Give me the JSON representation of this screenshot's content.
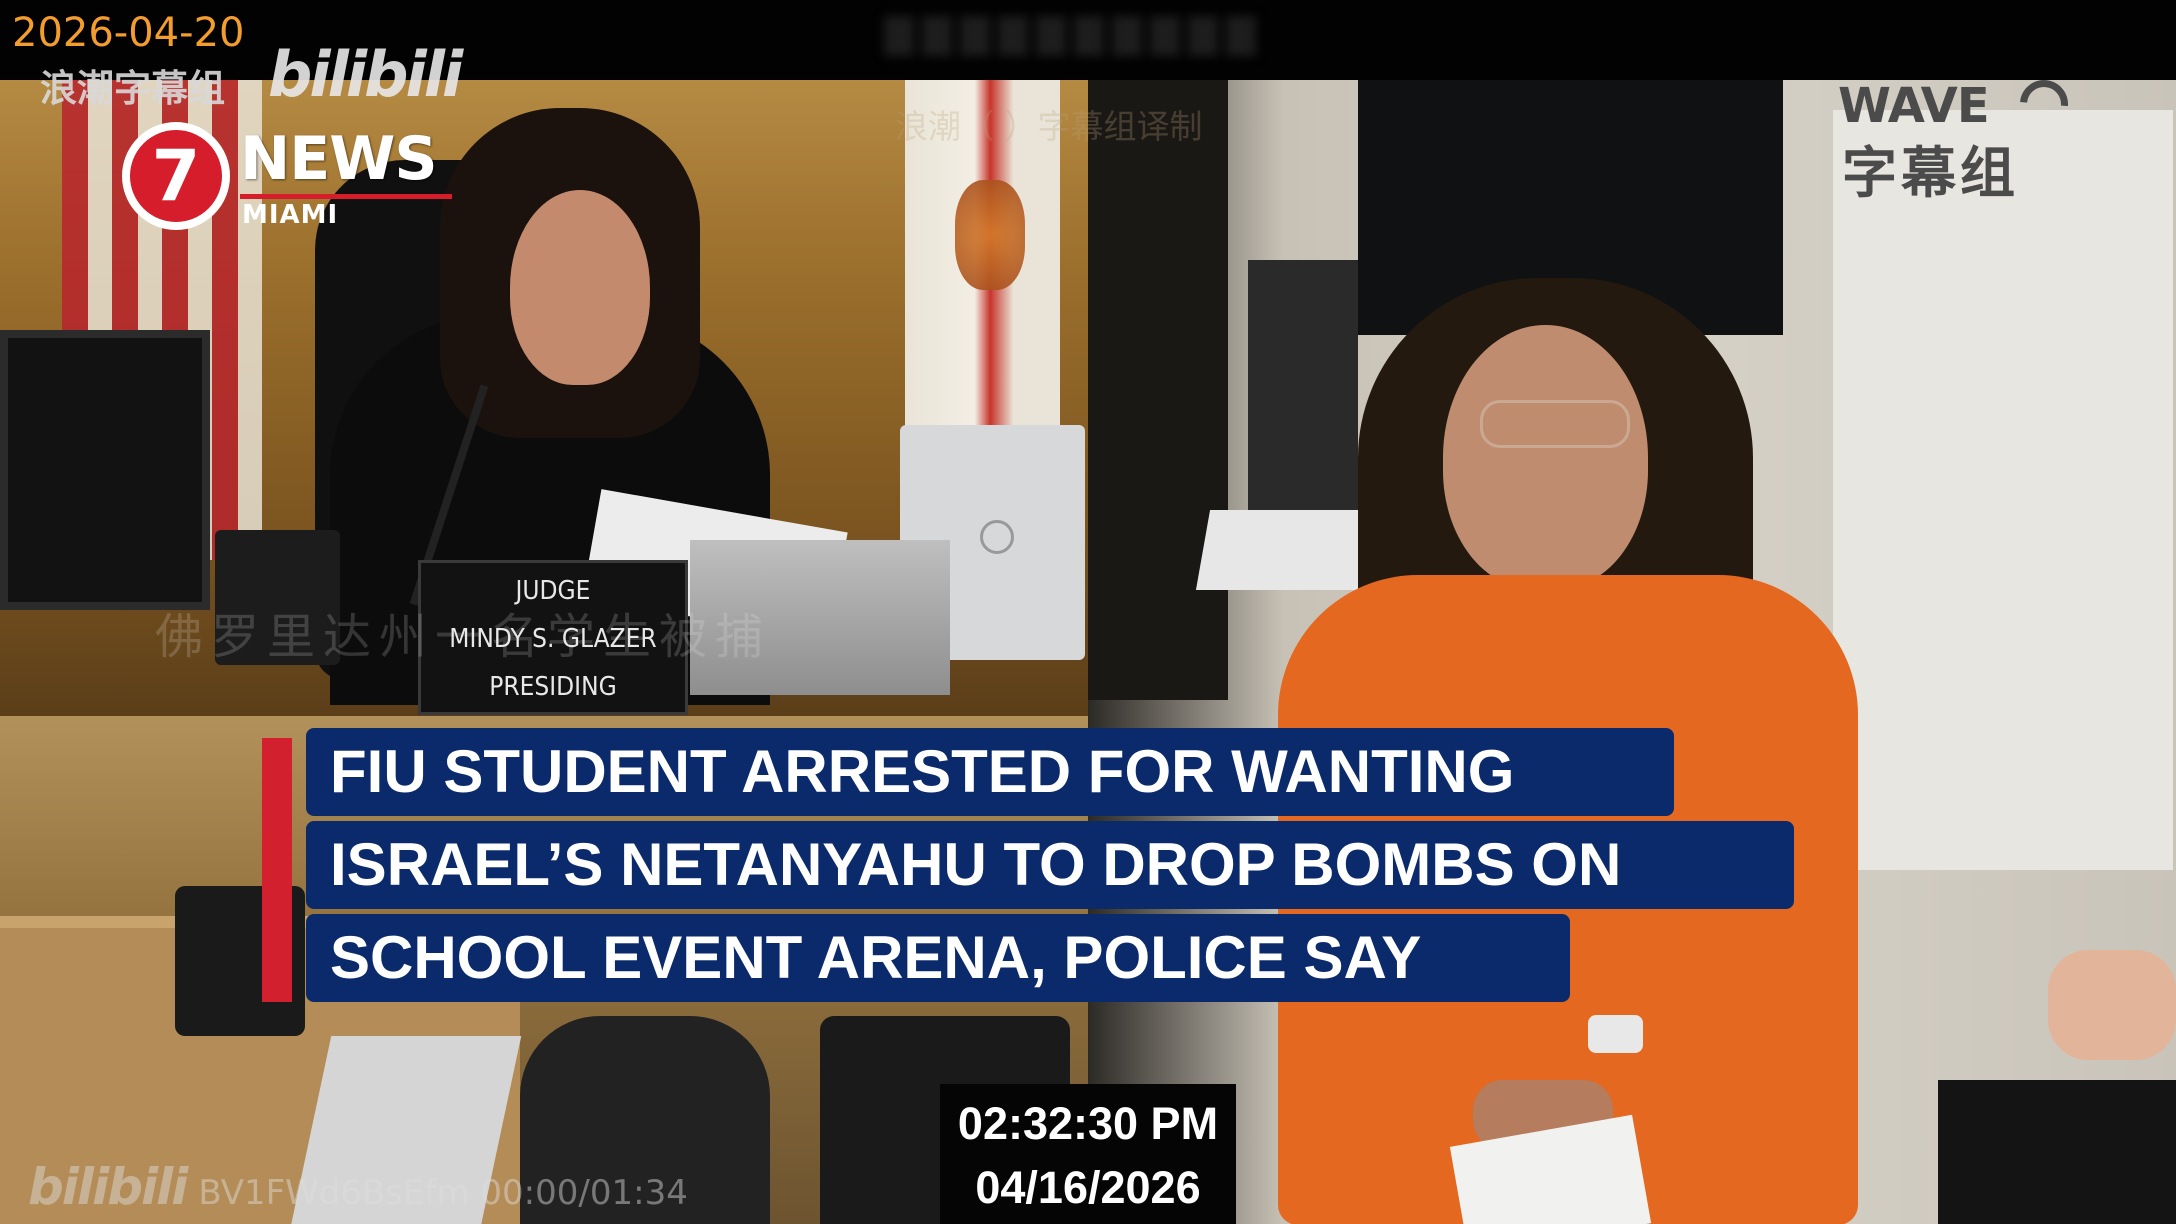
{
  "overlay": {
    "date": "2026-04-20",
    "group_name": "浪潮字幕组",
    "bilibili_logo": "bilibili",
    "bv_id": "BV1FWd6BsEfm",
    "playback_time": "00:00/01:34"
  },
  "station_logo": {
    "number": "7",
    "brand": "NEWS",
    "city": "MIAMI",
    "accent_color": "#d51d2b"
  },
  "wave_logo": {
    "name": "WAVE",
    "subtitle": "字幕组"
  },
  "faint_watermarks": {
    "credit": "浪潮（       ）字幕组译制",
    "subtitle": "佛罗里达州一名学生被捕"
  },
  "nameplate": {
    "line1": "JUDGE",
    "line2": "MINDY S. GLAZER",
    "line3": "PRESIDING"
  },
  "headline": {
    "line1": "FIU STUDENT ARRESTED FOR WANTING",
    "line2": "ISRAEL’S NETANYAHU TO DROP BOMBS ON",
    "line3": "SCHOOL EVENT ARENA, POLICE SAY",
    "bar_color": "#d3202e",
    "background_color": "#0b2a6b"
  },
  "timestamp": {
    "time": "02:32:30 PM",
    "date": "04/16/2026"
  }
}
